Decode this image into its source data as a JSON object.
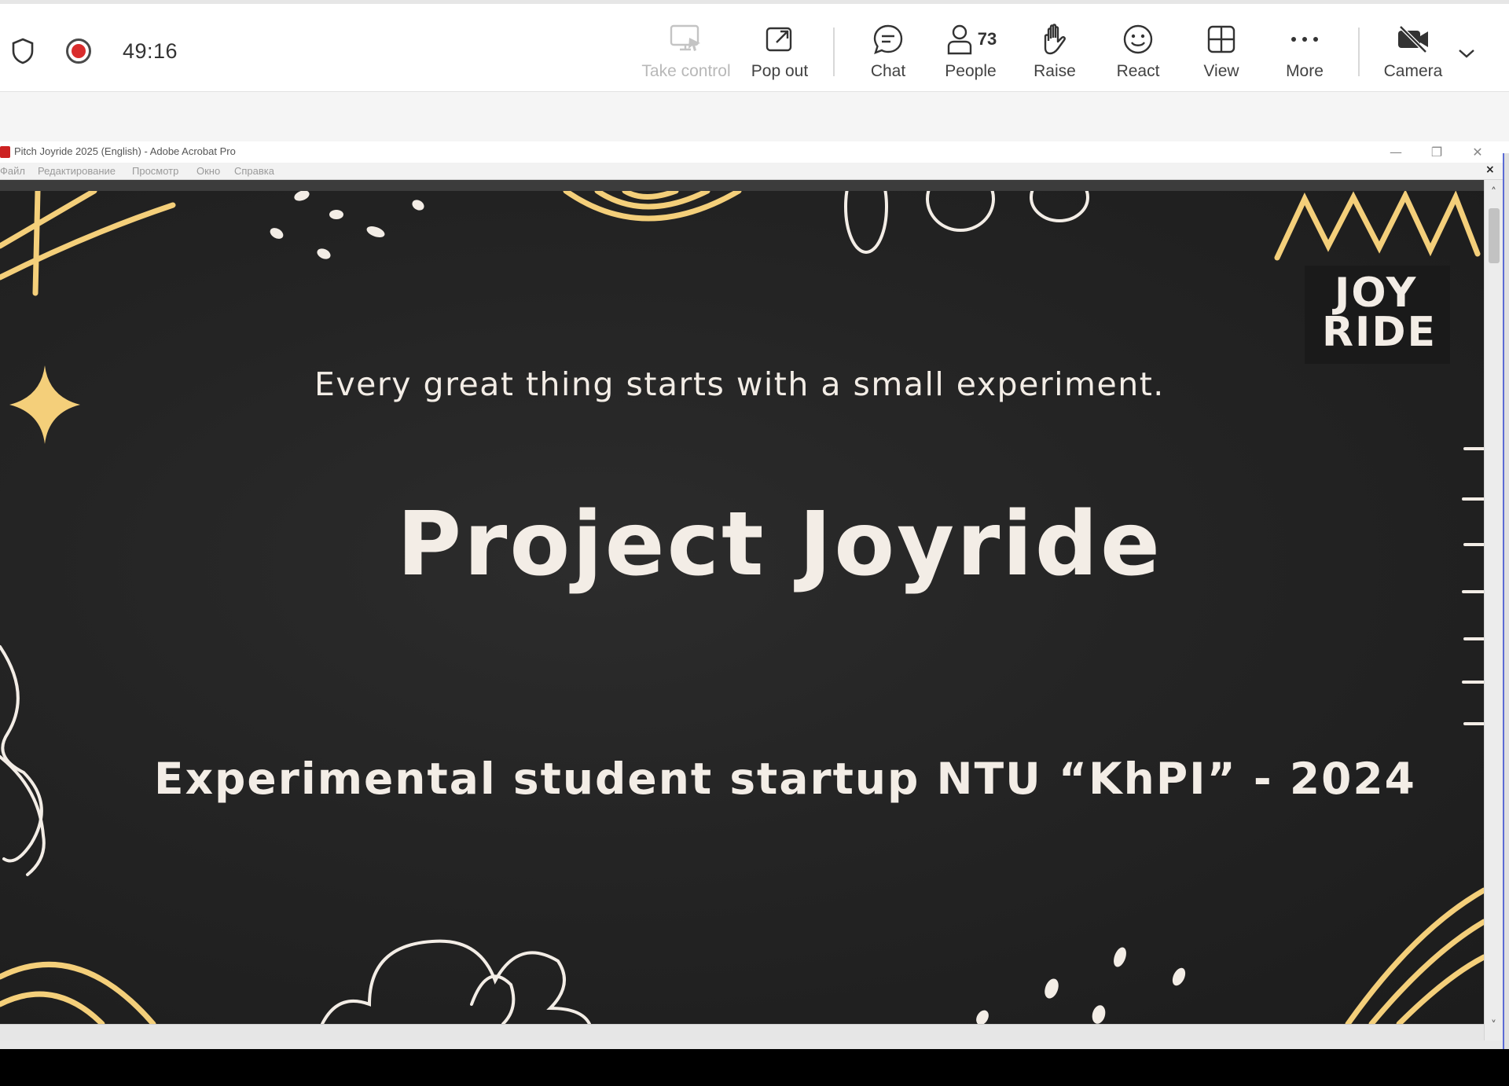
{
  "meeting": {
    "timer": "49:16",
    "people_count": "73",
    "buttons": {
      "take_control": "Take control",
      "pop_out": "Pop out",
      "chat": "Chat",
      "people": "People",
      "raise": "Raise",
      "react": "React",
      "view": "View",
      "more": "More",
      "camera": "Camera"
    },
    "icons": [
      "shield-icon",
      "recording-icon",
      "take-control-icon",
      "pop-out-icon",
      "chat-icon",
      "people-icon",
      "raise-hand-icon",
      "react-icon",
      "view-icon",
      "more-icon",
      "camera-off-icon",
      "chevron-down-icon"
    ],
    "colors": {
      "recording": "#d92c2c",
      "accent_edge": "#5b6bd5"
    }
  },
  "acrobat": {
    "window_title": "Pitch Joyride 2025 (English) - Adobe Acrobat Pro",
    "window_controls": {
      "minimize": "—",
      "restore": "❐",
      "close": "✕"
    },
    "menu": [
      "Файл",
      "Редактирование",
      "Просмотр",
      "Окно",
      "Справка"
    ],
    "menu_close": "×"
  },
  "slide": {
    "tagline": "Every great thing starts with a small experiment.",
    "title": "Project Joyride",
    "subtitle": "Experimental student startup NTU “KhPI” - 2024",
    "logo": {
      "line1": "JOY",
      "line2": "RIDE"
    },
    "colors": {
      "background": "#242424",
      "text": "#f3ede6",
      "accent": "#f4cf7a"
    }
  }
}
